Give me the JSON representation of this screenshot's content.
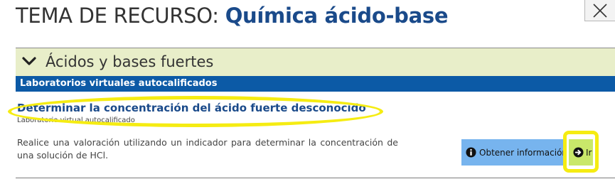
{
  "header": {
    "title_prefix": "TEMA DE RECURSO: ",
    "title_topic": "Química ácido-base"
  },
  "accordion": {
    "label": "Ácidos y bases fuertes",
    "expanded": true
  },
  "section": {
    "label": "Laboratorios virtuales autocalificados"
  },
  "resource": {
    "title": "Determinar la concentración del ácido fuerte desconocido",
    "type": "Laboratorio virtual autocalificado",
    "description": "Realice una valoración utilizando un indicador para determinar la concentración de una solución de HCl."
  },
  "buttons": {
    "info_label": "Obtener información",
    "go_label": "Ir"
  },
  "colors": {
    "title_accent": "#1a4a8a",
    "accordion_bg": "#e8eec9",
    "section_bar": "#0c5aa6",
    "info_button": "#77b4ee",
    "go_button": "#c9e86a",
    "highlight": "#f5ec12"
  },
  "icons": {
    "close": "close-icon",
    "accordion": "chevron-down-icon",
    "info": "info-icon",
    "go": "arrow-right-circle-icon"
  }
}
